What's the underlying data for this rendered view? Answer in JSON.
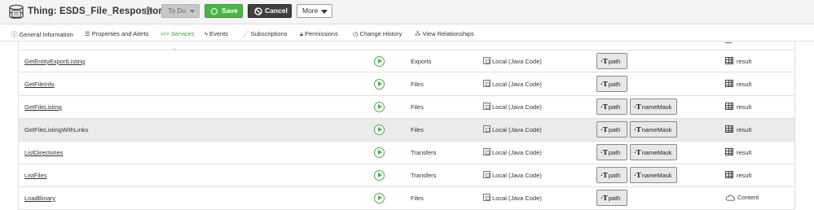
{
  "header": {
    "title": "Thing: ESDS_File_Respository",
    "help": "?",
    "state_button": "To Do",
    "save_button": "Save",
    "cancel_button": "Cancel",
    "more_button": "More"
  },
  "tabs": [
    {
      "label": "General Information",
      "icon": "info-icon"
    },
    {
      "label": "Properties and Alerts",
      "icon": "list-icon"
    },
    {
      "label": "Services",
      "icon": "code-icon",
      "active": true
    },
    {
      "label": "Events",
      "icon": "bolt-icon"
    },
    {
      "label": "Subscriptions",
      "icon": "rss-icon"
    },
    {
      "label": "Permissions",
      "icon": "lock-icon"
    },
    {
      "label": "Change History",
      "icon": "clock-icon"
    },
    {
      "label": "View Relationships",
      "icon": "sitemap-icon"
    }
  ],
  "colors": {
    "accent": "#4bb447",
    "active_tab": "#3aa33a",
    "highlight_row": "#ebebeb"
  },
  "services": [
    {
      "name": "GetEntityExportListing",
      "category": "Exports",
      "implementation": "Local (Java Code)",
      "inputs": [
        "path"
      ],
      "output": "result",
      "output_icon": "table-icon"
    },
    {
      "name": "GetFileInfo",
      "category": "Files",
      "implementation": "Local (Java Code)",
      "inputs": [
        "path"
      ],
      "output": "result",
      "output_icon": "table-icon"
    },
    {
      "name": "GetFileListing",
      "category": "Files",
      "implementation": "Local (Java Code)",
      "inputs": [
        "path",
        "nameMask"
      ],
      "output": "result",
      "output_icon": "table-icon"
    },
    {
      "name": "GetFileListingWithLinks",
      "category": "Files",
      "implementation": "Local (Java Code)",
      "inputs": [
        "path",
        "nameMask"
      ],
      "output": "result",
      "output_icon": "table-icon",
      "highlighted": true
    },
    {
      "name": "ListDirectories",
      "category": "Transfers",
      "implementation": "Local (Java Code)",
      "inputs": [
        "path",
        "nameMask"
      ],
      "output": "result",
      "output_icon": "table-icon"
    },
    {
      "name": "ListFiles",
      "category": "Transfers",
      "implementation": "Local (Java Code)",
      "inputs": [
        "path",
        "nameMask"
      ],
      "output": "result",
      "output_icon": "table-icon"
    },
    {
      "name": "LoadBinary",
      "category": "Files",
      "implementation": "Local (Java Code)",
      "inputs": [
        "path"
      ],
      "output": "Content",
      "output_icon": "cloud-icon"
    }
  ]
}
